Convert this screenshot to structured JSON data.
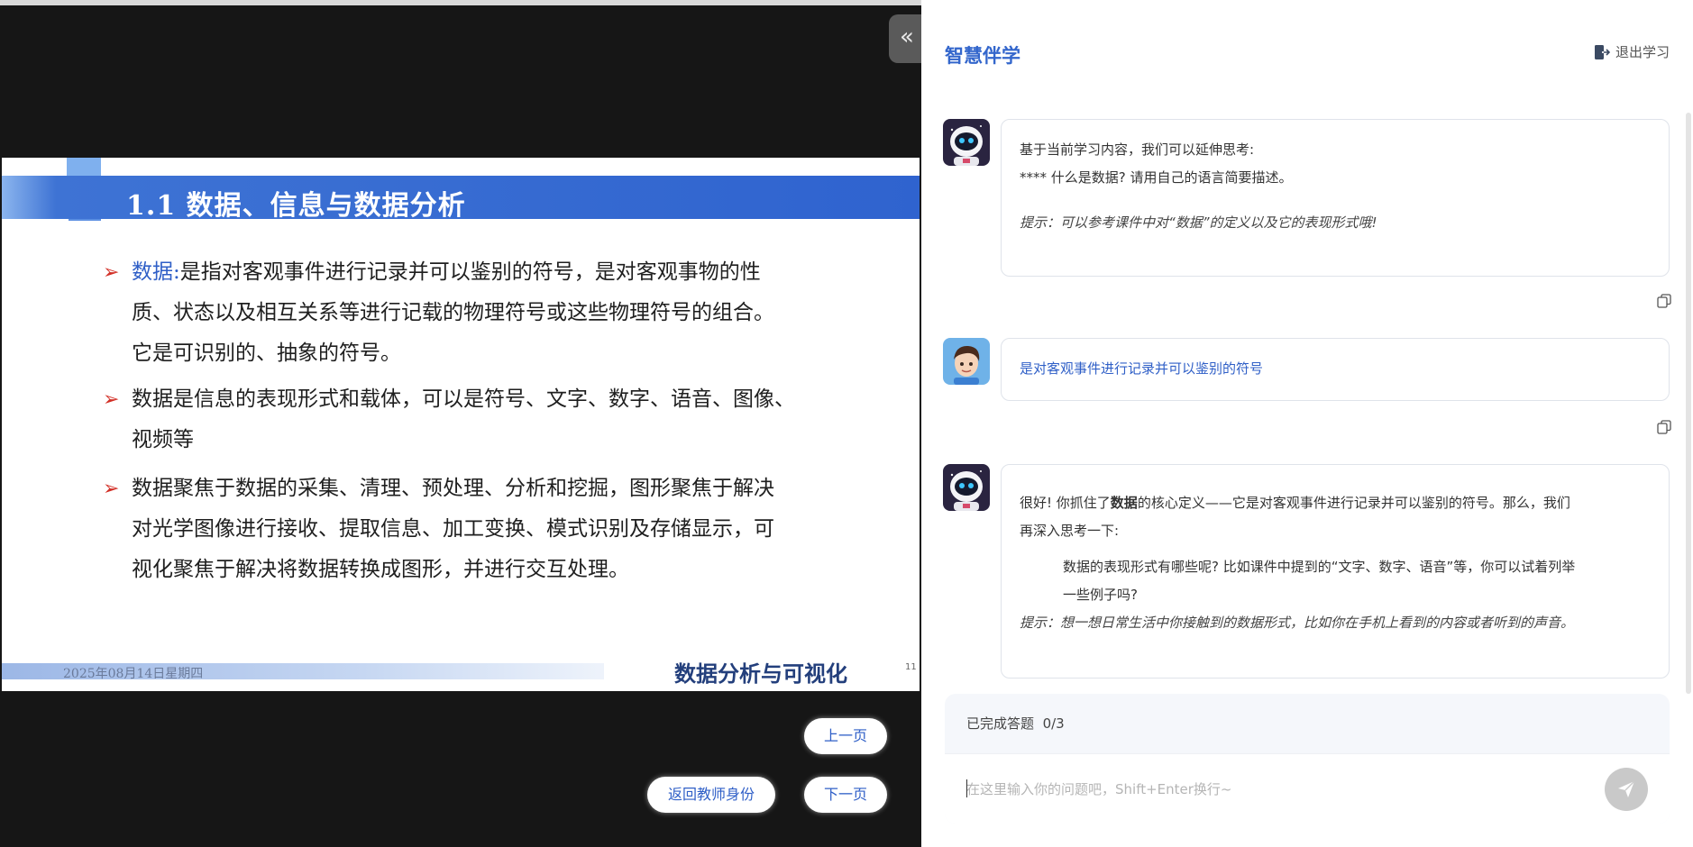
{
  "slide": {
    "title": "1.1 数据、信息与数据分析",
    "bullet_marker": "➢",
    "bullets": [
      {
        "keyword": "数据:",
        "lines": [
          "是指对客观事件进行记录并可以鉴别的符号，是对客观事物的性",
          "质、状态以及相互关系等进行记载的物理符号或这些物理符号的组合。",
          "它是可识别的、抽象的符号。"
        ]
      },
      {
        "lines": [
          "数据是信息的表现形式和载体，可以是符号、文字、数字、语音、图像、",
          "视频等"
        ]
      },
      {
        "lines": [
          "数据聚焦于数据的采集、清理、预处理、分析和挖掘，图形聚焦于解决",
          "对光学图像进行接收、提取信息、加工变换、模式识别及存储显示，可",
          "视化聚焦于解决将数据转换成图形，并进行交互处理。"
        ]
      }
    ],
    "footer_date": "2025年08月14日星期四",
    "footer_course": "数据分析与可视化",
    "page_number": "11"
  },
  "controls": {
    "collapse": "«",
    "prev": "上一页",
    "next": "下一页",
    "back_teacher": "返回教师身份"
  },
  "panel": {
    "title": "智慧伴学",
    "exit_label": "退出学习",
    "messages": [
      {
        "role": "assistant",
        "line1": "基于当前学习内容，我们可以延伸思考:",
        "line2": "**** 什么是数据? 请用自己的语言简要描述。",
        "hint": "提示：可以参考课件中对“数据”的定义以及它的表现形式哦!"
      },
      {
        "role": "user",
        "text": "是对客观事件进行记录并可以鉴别的符号"
      },
      {
        "role": "assistant",
        "p1_pre": "很好! 你抓住了",
        "p1_bold": "数据",
        "p1_post": "的核心定义——它是对客观事件进行记录并可以鉴别的符号。那么，我们",
        "p1_line2": "再深入思考一下:",
        "q_line1": "数据的表现形式有哪些呢? 比如课件中提到的“文字、数字、语音”等，你可以试着列举",
        "q_line2": "一些例子吗?",
        "hint": "提示：想一想日常生活中你接触到的数据形式，比如你在手机上看到的内容或者听到的声音。"
      }
    ],
    "progress_label": "已完成答题",
    "progress_value": "0/3",
    "input_placeholder": "在这里输入你的问题吧，Shift+Enter换行~"
  },
  "colors": {
    "accent": "#3366cc",
    "slide_band": "#2f63cf",
    "bullet_arrow": "#d22f26",
    "send_button": "#c9c9c9"
  }
}
